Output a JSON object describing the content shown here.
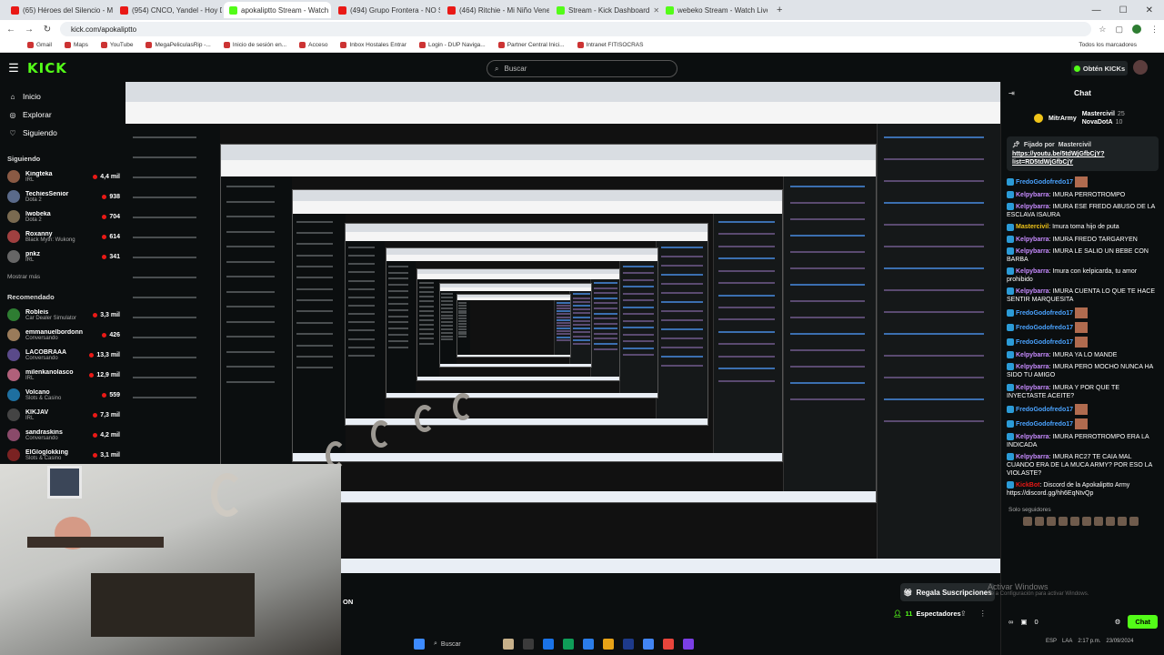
{
  "browser": {
    "tabs": [
      {
        "label": "(65) Héroes del Silencio - Mal...",
        "color": "#e91916",
        "active": false
      },
      {
        "label": "(954) CNCO, Yandel - Hoy DJ",
        "color": "#e91916",
        "active": false
      },
      {
        "label": "apokaliptto Stream - Watch Live",
        "color": "#53fc18",
        "active": true
      },
      {
        "label": "(494) Grupo Frontera - NO SE",
        "color": "#e91916",
        "active": false
      },
      {
        "label": "(464) Ritchie - Mi Niño Veneno",
        "color": "#e91916",
        "active": false
      },
      {
        "label": "Stream - Kick Dashboard",
        "color": "#53fc18",
        "active": false
      },
      {
        "label": "webeko Stream - Watch Live o...",
        "color": "#53fc18",
        "active": false
      }
    ],
    "new_tab": "+",
    "url": "kick.com/apokaliptto",
    "bookmarks": [
      "Gmail",
      "Maps",
      "YouTube",
      "MegaPeliculasRip -...",
      "Inicio de sesión en...",
      "Acceso",
      "Inbox Hostales Entrar",
      "Login - DUP Naviga...",
      "Partner Central Inici...",
      "Intranet FITISOCRAS"
    ],
    "bookmarks_right": "Todos los marcadores"
  },
  "kick": {
    "logo": "KICK",
    "search_placeholder": "Buscar",
    "kicks_button": "Obtén KICKs"
  },
  "sidebar": {
    "nav": [
      {
        "label": "Inicio",
        "icon": "home-icon"
      },
      {
        "label": "Explorar",
        "icon": "compass-icon"
      },
      {
        "label": "Siguiendo",
        "icon": "heart-icon"
      }
    ],
    "following_title": "Siguiendo",
    "following": [
      {
        "name": "Kingteka",
        "category": "IRL",
        "viewers": "4,4 mil",
        "color": "#8a5a44"
      },
      {
        "name": "TechiesSenior",
        "category": "Dota 2",
        "viewers": "938",
        "color": "#5a6a8a"
      },
      {
        "name": "lwobeka",
        "category": "Dota 2",
        "viewers": "704",
        "color": "#7a6a50"
      },
      {
        "name": "Roxanny",
        "category": "Black Myth: Wukong",
        "viewers": "614",
        "color": "#a04040"
      },
      {
        "name": "pnkz",
        "category": "IRL",
        "viewers": "341",
        "color": "#666666"
      }
    ],
    "show_more": "Mostrar más",
    "recommended_title": "Recomendado",
    "recommended": [
      {
        "name": "Robleis",
        "category": "Car Dealer Simulator",
        "viewers": "3,3 mil",
        "color": "#2e7d32"
      },
      {
        "name": "emmanuelbordonn",
        "category": "Conversando",
        "viewers": "426",
        "color": "#9a7b5a"
      },
      {
        "name": "LACOBRAAA",
        "category": "Conversando",
        "viewers": "13,3 mil",
        "color": "#5a4a8a"
      },
      {
        "name": "milenkanolasco",
        "category": "IRL",
        "viewers": "12,9 mil",
        "color": "#b0607a"
      },
      {
        "name": "Volcano",
        "category": "Slots & Casino",
        "viewers": "559",
        "color": "#1e6fa0"
      },
      {
        "name": "KIKJAV",
        "category": "IRL",
        "viewers": "7,3 mil",
        "color": "#444444"
      },
      {
        "name": "sandraskins",
        "category": "Conversando",
        "viewers": "4,2 mil",
        "color": "#8a4a6a"
      },
      {
        "name": "ElGloglokking",
        "category": "Slots & Casino",
        "viewers": "3,1 mil",
        "color": "#7a2222"
      }
    ]
  },
  "video": {
    "on_label": "ON",
    "gift_button": "Regala Suscripciones",
    "viewers_count": "11",
    "viewers_label": "Espectadores",
    "activate_windows": "Activar Windows",
    "activate_sub": "Ve a Configuración para activar Windows."
  },
  "taskbar": {
    "search": "Buscar",
    "icon_colors": [
      "#c7b08a",
      "#3b3b3b",
      "#1a73e8",
      "#0f9d58",
      "#2b7de9",
      "#e8a317",
      "#1e3a8a",
      "#4285f4",
      "#e8453c",
      "#7b3fe4"
    ],
    "tray": [
      "ESP",
      "LAA",
      "2:17 p.m.",
      "23/09/2024"
    ]
  },
  "chat": {
    "title": "Chat",
    "leaders": [
      {
        "name": "MitrArmy",
        "badge": "gold"
      },
      {
        "name": "Mastercivil",
        "score": "25"
      },
      {
        "name": "NovaDotA",
        "score": "10"
      }
    ],
    "pinned_by_label": "Fijado por",
    "pinned_by": "Mastercivil",
    "pinned_link": "https://youtu.be/5tdWjGfbCjY?list=RD5tdWjGfbCjY",
    "messages": [
      {
        "user": "FredoGodofredo17",
        "text": "",
        "ucolor": "#4aa3ff",
        "emote": true
      },
      {
        "user": "Kelpybarra",
        "text": "IMURA PERROTROMPO",
        "ucolor": "#c78bff"
      },
      {
        "user": "Kelpybarra",
        "text": "IMURA ESE FREDO ABUSO DE LA ESCLAVA ISAURA",
        "ucolor": "#c78bff"
      },
      {
        "user": "Mastercivil",
        "text": "Imura toma hijo de puta",
        "ucolor": "#f0c419"
      },
      {
        "user": "Kelpybarra",
        "text": "IMURA FREDO TARGARYEN",
        "ucolor": "#c78bff"
      },
      {
        "user": "Kelpybarra",
        "text": "IMURA LE SALIO UN BEBE CON BARBA",
        "ucolor": "#c78bff"
      },
      {
        "user": "Kelpybarra",
        "text": "Imura con kelpicarda, tu amor prohibido",
        "ucolor": "#c78bff"
      },
      {
        "user": "Kelpybarra",
        "text": "IMURA CUENTA LO QUE TE HACE SENTIR MARQUESITA",
        "ucolor": "#c78bff"
      },
      {
        "user": "FredoGodofredo17",
        "text": "",
        "ucolor": "#4aa3ff",
        "emote": true
      },
      {
        "user": "FredoGodofredo17",
        "text": "",
        "ucolor": "#4aa3ff",
        "emote": true
      },
      {
        "user": "FredoGodofredo17",
        "text": "",
        "ucolor": "#4aa3ff",
        "emote": true
      },
      {
        "user": "Kelpybarra",
        "text": "IMURA YA LO MANDE",
        "ucolor": "#c78bff"
      },
      {
        "user": "Kelpybarra",
        "text": "IMURA PERO MOCHO NUNCA HA SIDO TU AMIGO",
        "ucolor": "#c78bff"
      },
      {
        "user": "Kelpybarra",
        "text": "IMURA Y POR QUE TE INYECTASTE ACEITE?",
        "ucolor": "#c78bff"
      },
      {
        "user": "FredoGodofredo17",
        "text": "",
        "ucolor": "#4aa3ff",
        "emote": true
      },
      {
        "user": "FredoGodofredo17",
        "text": "",
        "ucolor": "#4aa3ff",
        "emote": true
      },
      {
        "user": "Kelpybarra",
        "text": "IMURA PERROTROMPO ERA LA INDICADA",
        "ucolor": "#c78bff"
      },
      {
        "user": "Kelpybarra",
        "text": "IMURA RC27 TE CAIA MAL CUANDO ERA DE LA MUCA ARMY? POR ESO LA VIOLASTE?",
        "ucolor": "#c78bff"
      },
      {
        "user": "KickBot",
        "text": "Discord de la Apokaliptto Army https://discord.gg/hh6EqNtvQp",
        "ucolor": "#e91916"
      }
    ],
    "subs_only": "Solo seguidores",
    "kicks_count": "0",
    "chat_button": "Chat"
  }
}
